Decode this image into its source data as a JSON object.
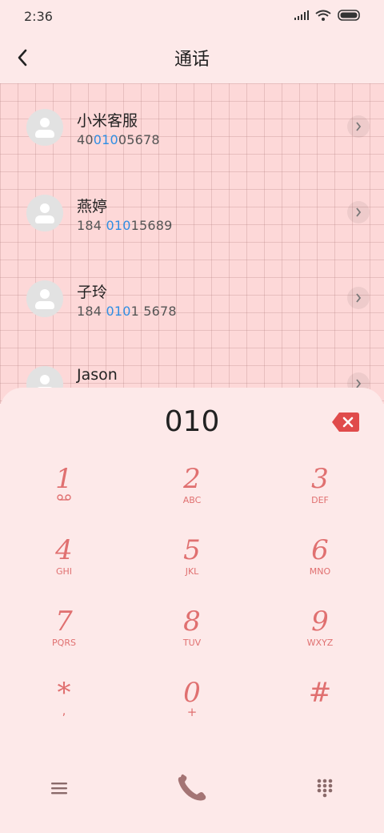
{
  "status": {
    "time": "2:36"
  },
  "header": {
    "title": "通话"
  },
  "contacts": [
    {
      "name": "小米客服",
      "num_pre": "40",
      "num_hl": "010",
      "num_post": "05678"
    },
    {
      "name": "燕婷",
      "num_pre": "184 ",
      "num_hl": "010",
      "num_post": "15689"
    },
    {
      "name": "子玲",
      "num_pre": "184 ",
      "num_hl": "010",
      "num_post": "1 5678"
    },
    {
      "name": "Jason",
      "num_pre": "",
      "num_hl": "",
      "num_post": ""
    }
  ],
  "dialpad": {
    "input": "010",
    "keys": [
      {
        "digit": "1",
        "letters": "voicemail-icon"
      },
      {
        "digit": "2",
        "letters": "ABC"
      },
      {
        "digit": "3",
        "letters": "DEF"
      },
      {
        "digit": "4",
        "letters": "GHI"
      },
      {
        "digit": "5",
        "letters": "JKL"
      },
      {
        "digit": "6",
        "letters": "MNO"
      },
      {
        "digit": "7",
        "letters": "PQRS"
      },
      {
        "digit": "8",
        "letters": "TUV"
      },
      {
        "digit": "9",
        "letters": "WXYZ"
      },
      {
        "digit": "*",
        "letters": ","
      },
      {
        "digit": "0",
        "letters": "+"
      },
      {
        "digit": "#",
        "letters": ""
      }
    ]
  },
  "colors": {
    "accent": "#e07070",
    "highlight": "#2f8ee3",
    "backspace": "#e04b4b"
  }
}
